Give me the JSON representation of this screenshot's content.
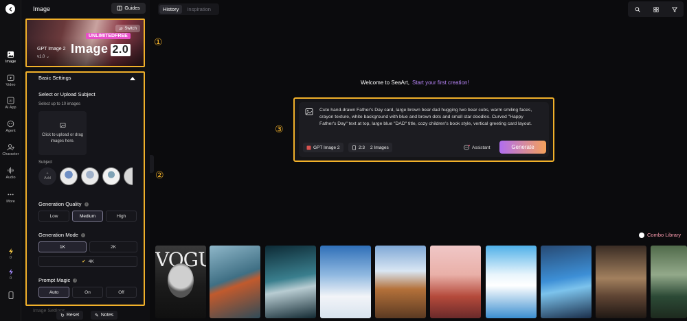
{
  "panel": {
    "title": "Image",
    "guides_label": "Guides",
    "model": {
      "switch_label": "Switch",
      "badge": "UNLIMITEDFREE",
      "big_title": "Image",
      "big_version": "2.0",
      "name": "GPT Image 2",
      "version": "v1.0"
    },
    "basic_settings": {
      "title": "Basic Settings",
      "upload_title": "Select or Upload Subject",
      "upload_sub": "Select up to 10 images",
      "upload_box": "Click to upload or drag images here.",
      "subject_label": "Subject",
      "add_label": "Add",
      "quality": {
        "title": "Generation Quality",
        "options": [
          "Low",
          "Medium",
          "High"
        ],
        "selected": "Medium"
      },
      "mode": {
        "title": "Generation Mode",
        "options": [
          "1K",
          "2K",
          "4K"
        ],
        "selected": "1K"
      },
      "magic": {
        "title": "Prompt Magic",
        "options": [
          "Auto",
          "On",
          "Off"
        ],
        "selected": "Auto"
      }
    },
    "footer": {
      "next_section": "Image Settings",
      "reset_label": "Reset",
      "notes_label": "Notes"
    }
  },
  "rail": {
    "items": [
      {
        "label": "Image",
        "icon": "image-icon"
      },
      {
        "label": "Video",
        "icon": "video-icon"
      },
      {
        "label": "AI App",
        "icon": "ai-app-icon"
      },
      {
        "label": "Agent",
        "icon": "agent-icon"
      },
      {
        "label": "Character",
        "icon": "character-icon"
      },
      {
        "label": "Audio",
        "icon": "audio-icon"
      },
      {
        "label": "More",
        "icon": "more-icon"
      }
    ],
    "counters": [
      "0",
      "0"
    ]
  },
  "top": {
    "tabs": [
      "History",
      "Inspiration"
    ],
    "active_tab": "History"
  },
  "welcome": {
    "text": "Welcome to SeaArt,",
    "accent": "Start your first creation!"
  },
  "prompt": {
    "text": "Cute hand-drawn Father's Day card, large brown bear dad hugging two bear cubs, warm smiling faces, crayon texture, white background with blue and brown dots and small star doodles. Curved \"Happy Father's Day\" text at top, large blue \"DAD\" title, cozy children's book style, vertical greeting card layout.",
    "model_chip": "GPT Image 2",
    "ratio_chip": "2:3",
    "count_chip": "2 Images",
    "assistant_label": "Assistant",
    "generate_label": "Generate"
  },
  "annotations": [
    "①",
    "②",
    "③"
  ],
  "combo_label": "Combo Library",
  "gallery": {
    "vogue_text": "VOGU"
  },
  "colors": {
    "highlight": "#f2b12a",
    "accent": "#b684f5",
    "generate_start": "#b06ef0",
    "generate_end": "#f5a15a"
  }
}
